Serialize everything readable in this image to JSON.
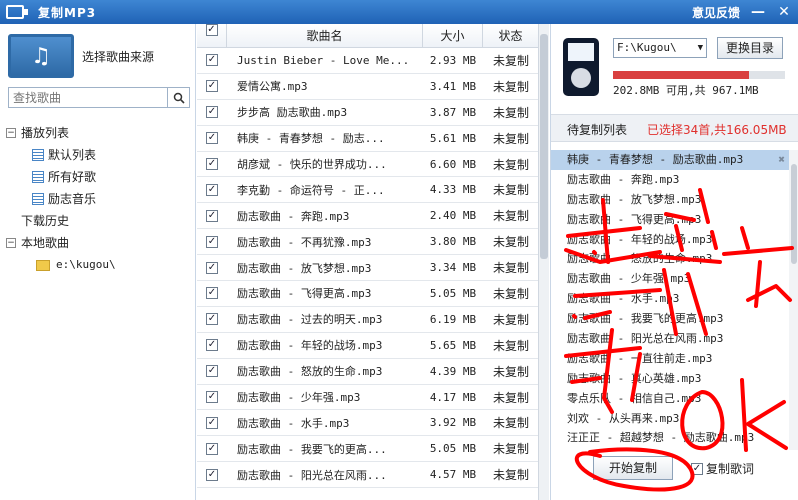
{
  "titlebar": {
    "title": "复制MP3",
    "feedback": "意见反馈",
    "minimize": "—",
    "close": "✕"
  },
  "left": {
    "source_label": "选择歌曲来源",
    "search_placeholder": "查找歌曲",
    "tree": {
      "playlists": "播放列表",
      "default_list": "默认列表",
      "favorites": "所有好歌",
      "inspiration": "励志音乐",
      "download_history": "下载历史",
      "local_songs": "本地歌曲",
      "local_folder": "e:\\kugou\\"
    }
  },
  "table": {
    "headers": {
      "name": "歌曲名",
      "size": "大小",
      "status": "状态"
    },
    "rows": [
      {
        "name": "Justin Bieber - Love Me...",
        "size": "2.93 MB",
        "status": "未复制"
      },
      {
        "name": "爱情公寓.mp3",
        "size": "3.41 MB",
        "status": "未复制"
      },
      {
        "name": "步步高 励志歌曲.mp3",
        "size": "3.87 MB",
        "status": "未复制"
      },
      {
        "name": "韩庚 - 青春梦想 - 励志...",
        "size": "5.61 MB",
        "status": "未复制"
      },
      {
        "name": "胡彦斌 - 快乐的世界成功...",
        "size": "6.60 MB",
        "status": "未复制"
      },
      {
        "name": "李克勤 - 命运符号 - 正...",
        "size": "4.33 MB",
        "status": "未复制"
      },
      {
        "name": "励志歌曲 - 奔跑.mp3",
        "size": "2.40 MB",
        "status": "未复制"
      },
      {
        "name": "励志歌曲 - 不再犹豫.mp3",
        "size": "3.80 MB",
        "status": "未复制"
      },
      {
        "name": "励志歌曲 - 放飞梦想.mp3",
        "size": "3.34 MB",
        "status": "未复制"
      },
      {
        "name": "励志歌曲 - 飞得更高.mp3",
        "size": "5.05 MB",
        "status": "未复制"
      },
      {
        "name": "励志歌曲 - 过去的明天.mp3",
        "size": "6.19 MB",
        "status": "未复制"
      },
      {
        "name": "励志歌曲 - 年轻的战场.mp3",
        "size": "5.65 MB",
        "status": "未复制"
      },
      {
        "name": "励志歌曲 - 怒放的生命.mp3",
        "size": "4.39 MB",
        "status": "未复制"
      },
      {
        "name": "励志歌曲 - 少年强.mp3",
        "size": "4.17 MB",
        "status": "未复制"
      },
      {
        "name": "励志歌曲 - 水手.mp3",
        "size": "3.92 MB",
        "status": "未复制"
      },
      {
        "name": "励志歌曲 - 我要飞的更高...",
        "size": "5.05 MB",
        "status": "未复制"
      },
      {
        "name": "励志歌曲 - 阳光总在风雨...",
        "size": "4.57 MB",
        "status": "未复制"
      }
    ]
  },
  "device": {
    "drive": "F:\\Kugou\\",
    "change_dir": "更换目录",
    "capacity_used_fraction": 0.79,
    "capacity_text": "202.8MB 可用,共 967.1MB"
  },
  "pending": {
    "title": "待复制列表",
    "count_text": "已选择34首,共166.05MB",
    "items": [
      "韩庚 - 青春梦想 - 励志歌曲.mp3",
      "励志歌曲 - 奔跑.mp3",
      "励志歌曲 - 放飞梦想.mp3",
      "励志歌曲 - 飞得更高.mp3",
      "励志歌曲 - 年轻的战场.mp3",
      "励志歌曲 - 怒放的生命.mp3",
      "励志歌曲 - 少年强.mp3",
      "励志歌曲 - 水手.mp3",
      "励志歌曲 - 我要飞的更高.mp3",
      "励志歌曲 - 阳光总在风雨.mp3",
      "励志歌曲 - 一直往前走.mp3",
      "励志歌曲 - 真心英雄.mp3",
      "零点乐队 - 相信自己.mp3",
      "刘欢 - 从头再来.mp3",
      "汪正正 - 超越梦想 - 励志歌曲.mp3"
    ],
    "start_button": "开始复制",
    "copy_lyrics": "复制歌词"
  },
  "colors": {
    "titlebar": "#2a70c2",
    "accent_red": "#e0302d",
    "selected_row": "#b9d2ec",
    "annotation_ink": "#ff0000"
  }
}
